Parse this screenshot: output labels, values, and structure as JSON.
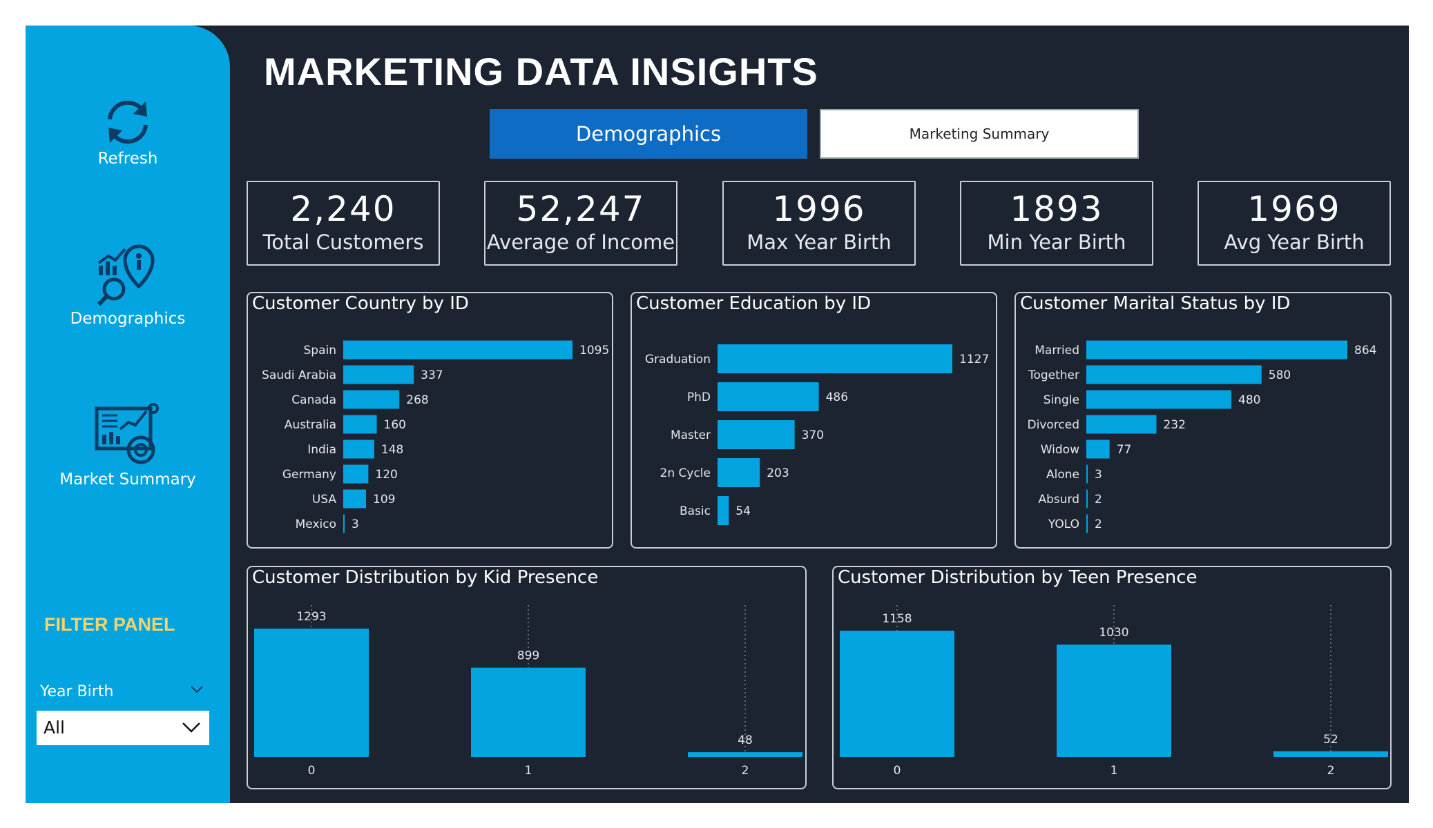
{
  "title": "MARKETING DATA INSIGHTS",
  "sidebar": {
    "items": [
      {
        "label": "Refresh",
        "icon": "refresh-icon"
      },
      {
        "label": "Demographics",
        "icon": "demographics-icon"
      },
      {
        "label": "Market Summary",
        "icon": "market-summary-icon"
      }
    ],
    "filter_title": "FILTER PANEL",
    "year_birth_label": "Year Birth",
    "year_birth_value": "All"
  },
  "tabs": [
    {
      "label": "Demographics",
      "active": true
    },
    {
      "label": "Marketing Summary",
      "active": false
    }
  ],
  "kpis": [
    {
      "value": "2,240",
      "label": "Total Customers"
    },
    {
      "value": "52,247",
      "label": "Average of  Income"
    },
    {
      "value": "1996",
      "label": "Max Year Birth"
    },
    {
      "value": "1893",
      "label": "Min Year Birth"
    },
    {
      "value": "1969",
      "label": "Avg Year Birth"
    }
  ],
  "colors": {
    "bar": "#03a4e0",
    "background": "#1c2331",
    "sidebar": "#03a4e0",
    "accent_tab": "#0f6cc4",
    "filter_title": "#f5d36a"
  },
  "chart_data": [
    {
      "id": "country",
      "type": "bar",
      "orientation": "horizontal",
      "title": "Customer Country by ID",
      "categories": [
        "Spain",
        "Saudi Arabia",
        "Canada",
        "Australia",
        "India",
        "Germany",
        "USA",
        "Mexico"
      ],
      "values": [
        1095,
        337,
        268,
        160,
        148,
        120,
        109,
        3
      ]
    },
    {
      "id": "education",
      "type": "bar",
      "orientation": "horizontal",
      "title": "Customer Education by ID",
      "categories": [
        "Graduation",
        "PhD",
        "Master",
        "2n Cycle",
        "Basic"
      ],
      "values": [
        1127,
        486,
        370,
        203,
        54
      ]
    },
    {
      "id": "marital",
      "type": "bar",
      "orientation": "horizontal",
      "title": "Customer Marital Status by ID",
      "categories": [
        "Married",
        "Together",
        "Single",
        "Divorced",
        "Widow",
        "Alone",
        "Absurd",
        "YOLO"
      ],
      "values": [
        864,
        580,
        480,
        232,
        77,
        3,
        2,
        2
      ]
    },
    {
      "id": "kid",
      "type": "bar",
      "orientation": "vertical",
      "title": "Customer Distribution by Kid Presence",
      "categories": [
        "0",
        "1",
        "2"
      ],
      "values": [
        1293,
        899,
        48
      ]
    },
    {
      "id": "teen",
      "type": "bar",
      "orientation": "vertical",
      "title": "Customer Distribution by Teen Presence",
      "categories": [
        "0",
        "1",
        "2"
      ],
      "values": [
        1158,
        1030,
        52
      ]
    }
  ]
}
